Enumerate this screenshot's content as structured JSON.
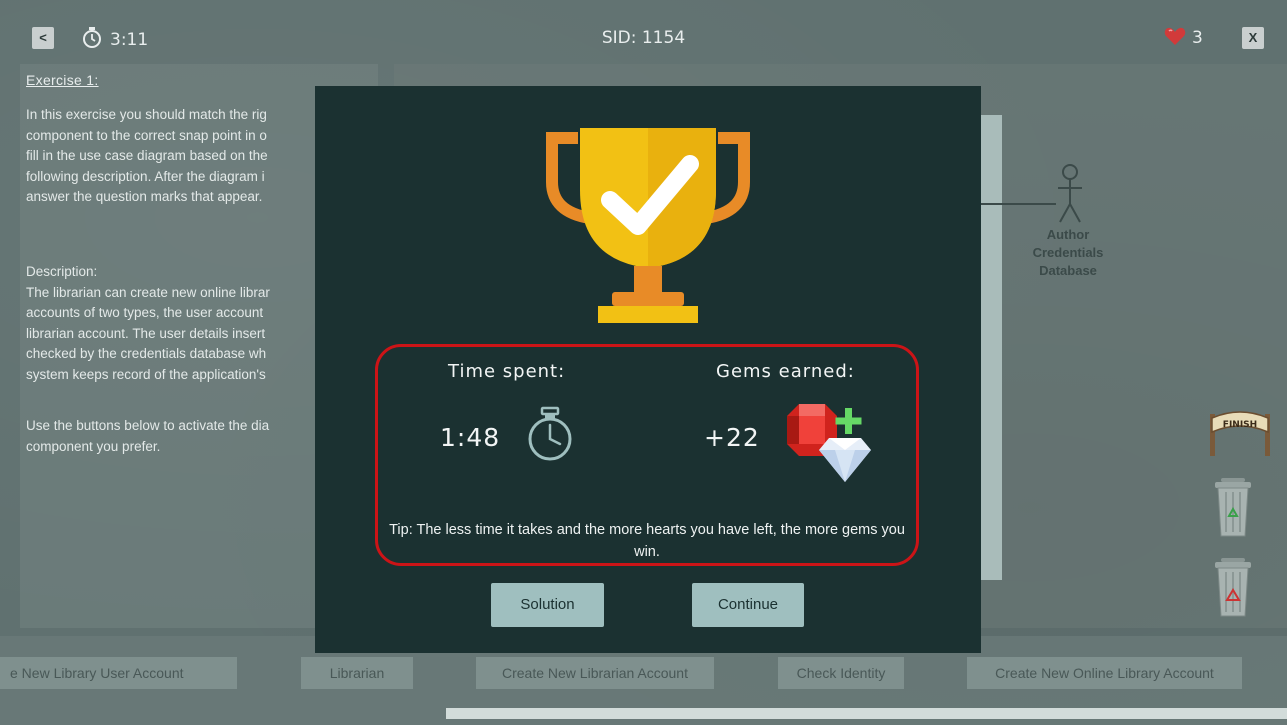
{
  "topbar": {
    "back_label": "<",
    "timer": "3:11",
    "sid": "SID: 1154",
    "hearts": "3",
    "close_label": "X"
  },
  "exercise": {
    "title": "Exercise 1:",
    "intro": "In this exercise you should match the rig\ncomponent to the correct snap point in o\nfill in the use case diagram based on the\nfollowing description. After the diagram i\nanswer the question marks that appear.",
    "description_lines": "Description:\nThe librarian can create new online librar\naccounts of two types, the user account\nlibrarian account. The user details insert\nchecked by the credentials database wh\nsystem keeps record of the application's",
    "instruction": "Use the buttons below to activate the dia\ncomponent you prefer."
  },
  "diagram": {
    "actor_label": "Author\nCredentials\nDatabase"
  },
  "components": [
    "e New Library User Account",
    "Librarian",
    "Create New Librarian Account",
    "Check Identity",
    "Create New Online Library Account"
  ],
  "side": {
    "finish_label": "FINISH"
  },
  "modal": {
    "time_heading": "Time spent:",
    "time_value": "1:48",
    "gems_heading": "Gems earned:",
    "gems_value": "+22",
    "tip": "Tip: The less time it takes and the more hearts you have left, the more gems you win.",
    "solution_label": "Solution",
    "continue_label": "Continue"
  },
  "colors": {
    "modal_bg": "#1b3131",
    "highlight_border": "#cc1417",
    "trophy_gold": "#f2c114",
    "button_bg": "#9fbfbf"
  }
}
